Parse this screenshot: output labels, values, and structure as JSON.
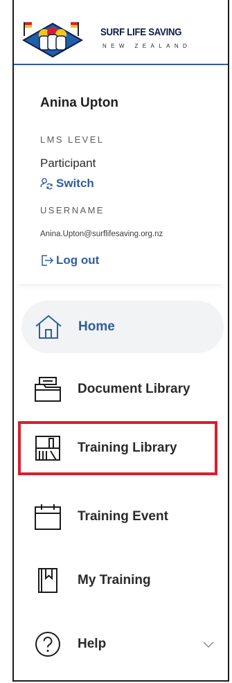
{
  "brand": {
    "title": "SURF LIFE SAVING",
    "subtitle": "NEW ZEALAND",
    "primary_color": "#2f5d9e",
    "highlight_color": "#d81e2c"
  },
  "user": {
    "name": "Anina Upton",
    "lms_level_label": "LMS LEVEL",
    "lms_level_value": "Participant",
    "switch_label": "Switch",
    "username_label": "USERNAME",
    "username_value": "Anina.Upton@surflifesaving.org.nz",
    "logout_label": "Log out"
  },
  "nav": {
    "items": [
      {
        "label": "Home",
        "icon": "home-icon"
      },
      {
        "label": "Document Library",
        "icon": "folder-icon"
      },
      {
        "label": "Training Library",
        "icon": "bookshelf-icon"
      },
      {
        "label": "Training Event",
        "icon": "calendar-icon"
      },
      {
        "label": "My Training",
        "icon": "bookmark-book-icon"
      },
      {
        "label": "Help",
        "icon": "help-circle-icon"
      }
    ]
  }
}
